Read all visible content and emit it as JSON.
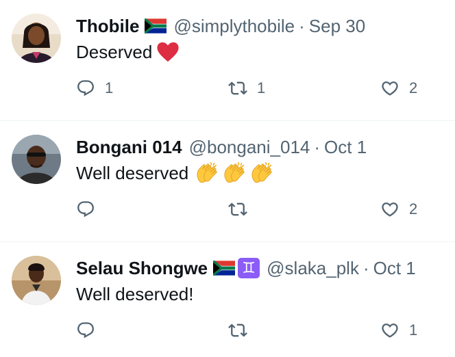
{
  "replies": [
    {
      "name": "Thobile",
      "handle": "@simplythobile",
      "time": "Sep 30",
      "text": "Deserved",
      "emoji": "red-heart",
      "flags": [
        "south-africa-flag"
      ],
      "reply_count": "1",
      "retweet_count": "1",
      "like_count": "2"
    },
    {
      "name": "Bongani 014",
      "handle": "@bongani_014",
      "time": "Oct 1",
      "text": "Well deserved",
      "emoji": "clapping-hands x3",
      "flags": [],
      "reply_count": "",
      "retweet_count": "",
      "like_count": "2"
    },
    {
      "name": "Selau Shongwe",
      "handle": "@slaka_plk",
      "time": "Oct 1",
      "text": "Well deserved!",
      "emoji": "",
      "flags": [
        "south-africa-flag",
        "gemini-icon"
      ],
      "gemini_symbol": "♊",
      "reply_count": "",
      "retweet_count": "",
      "like_count": "1"
    }
  ],
  "separator": "·",
  "colors": {
    "text_primary": "#0f1419",
    "text_secondary": "#536471",
    "divider": "#eff3f4",
    "heart_red": "#e0245e",
    "gemini_purple": "#8b5cf6"
  }
}
